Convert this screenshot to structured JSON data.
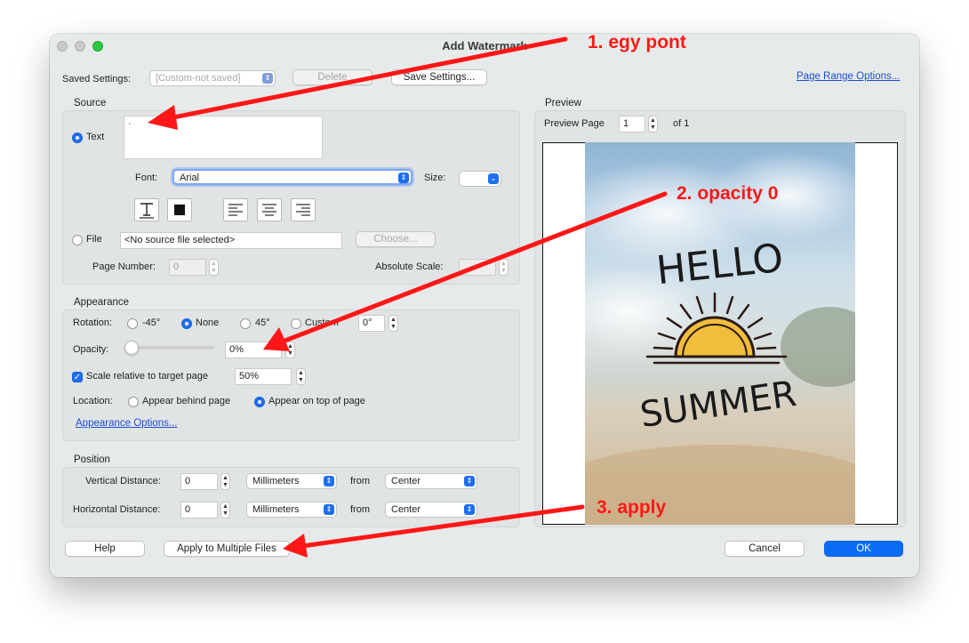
{
  "window": {
    "title": "Add Watermark"
  },
  "saved_settings": {
    "label": "Saved Settings:",
    "value": "[Custom-not saved]",
    "delete_label": "Delete",
    "save_label": "Save Settings...",
    "page_range_link": "Page Range Options..."
  },
  "source": {
    "title": "Source",
    "text_radio_label": "Text",
    "text_value": "·",
    "font_label": "Font:",
    "font_value": "Arial",
    "size_label": "Size:",
    "size_value": "",
    "file_radio_label": "File",
    "file_value": "<No source file selected>",
    "choose_label": "Choose...",
    "page_number_label": "Page Number:",
    "page_number_value": "0",
    "absolute_scale_label": "Absolute Scale:",
    "absolute_scale_value": ""
  },
  "appearance": {
    "title": "Appearance",
    "rotation_label": "Rotation:",
    "rotation_options": [
      "-45°",
      "None",
      "45°",
      "Custom"
    ],
    "rotation_selected": "None",
    "rotation_custom_value": "0°",
    "opacity_label": "Opacity:",
    "opacity_value": "0%",
    "opacity_level": 0,
    "scale_label": "Scale relative to target page",
    "scale_checked": true,
    "scale_value": "50%",
    "location_label": "Location:",
    "location_behind": "Appear behind page",
    "location_top": "Appear on top of page",
    "location_selected": "Appear on top of page",
    "options_link": "Appearance Options..."
  },
  "position": {
    "title": "Position",
    "vertical_label": "Vertical Distance:",
    "vertical_value": "0",
    "vertical_unit": "Millimeters",
    "vertical_from_label": "from",
    "vertical_from": "Center",
    "horizontal_label": "Horizontal Distance:",
    "horizontal_value": "0",
    "horizontal_unit": "Millimeters",
    "horizontal_from_label": "from",
    "horizontal_from": "Center"
  },
  "preview": {
    "title": "Preview",
    "page_label": "Preview Page",
    "page_value": "1",
    "of_label": "of 1",
    "image_text_top": "HELLO",
    "image_text_bottom": "SUMMER"
  },
  "footer": {
    "help": "Help",
    "apply_multiple": "Apply to Multiple Files",
    "cancel": "Cancel",
    "ok": "OK"
  },
  "annotations": {
    "step1": "1. egy pont",
    "step2": "2. opacity 0",
    "step3": "3. apply"
  },
  "colors": {
    "accent": "#1f6ef2",
    "annotation": "#ff1717",
    "sun": "#f0bd3c",
    "ink": "#2b1a14"
  }
}
